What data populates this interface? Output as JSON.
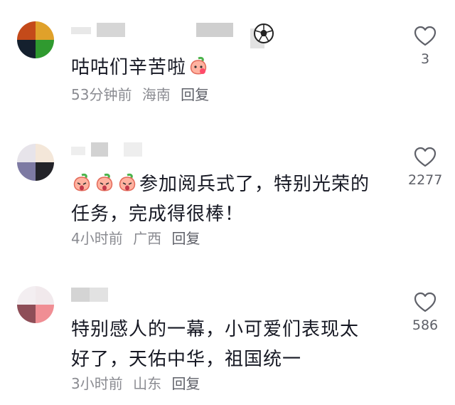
{
  "comments": [
    {
      "text": "咕咕们辛苦啦",
      "time": "53分钟前",
      "location": "海南",
      "reply": "回复",
      "likes": "3",
      "avatar_colors": [
        "#c44a1a",
        "#e0a12a",
        "#14202e",
        "#2f9a2f"
      ],
      "emoji_after": 1,
      "emoji_before": 0
    },
    {
      "text": "参加阅兵式了，特别光荣的任务，完成得很棒！",
      "line1": "参加阅兵式了，特别光荣的",
      "line2": "任务，完成得很棒！",
      "time": "4小时前",
      "location": "广西",
      "reply": "回复",
      "likes": "2277",
      "avatar_colors": [
        "#e7e4ea",
        "#f4e7d9",
        "#7d7aa3",
        "#232329"
      ],
      "emoji_before": 3,
      "emoji_after": 0
    },
    {
      "text": "特别感人的一幕，小可爱们表现太好了，天佑中华，祖国统一",
      "line1": "特别感人的一幕，小可爱们表现太",
      "line2": "好了，天佑中华，祖国统一",
      "time": "3小时前",
      "location": "山东",
      "reply": "回复",
      "likes": "586",
      "avatar_colors": [
        "#f3eef1",
        "#f1e9ec",
        "#8e4e58",
        "#f08e94"
      ],
      "emoji_before": 0,
      "emoji_after": 0
    }
  ]
}
